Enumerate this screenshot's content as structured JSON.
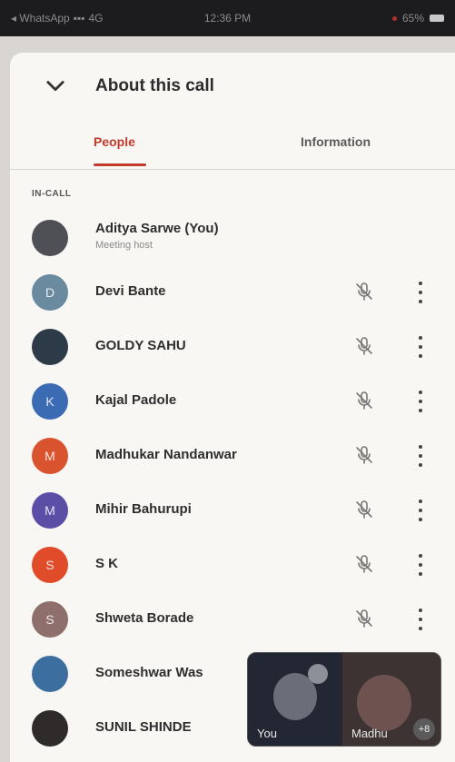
{
  "status_bar": {
    "carrier": "◂ WhatsApp",
    "network": "4G",
    "time": "12:36 PM",
    "battery": "65%"
  },
  "header": {
    "title": "About this call",
    "back_icon": "chevron-down-icon"
  },
  "tabs": [
    {
      "label": "People",
      "active": true
    },
    {
      "label": "Information",
      "active": false
    }
  ],
  "section_label": "IN-CALL",
  "participants": [
    {
      "name": "Aditya Sarwe (You)",
      "subtitle": "Meeting host",
      "initial": "",
      "avatar_color": "#4e5055",
      "is_host": true
    },
    {
      "name": "Devi Bante",
      "initial": "D",
      "avatar_color": "#6a8aa0"
    },
    {
      "name": "GOLDY SAHU",
      "initial": "",
      "avatar_color": "#2d3a48"
    },
    {
      "name": "Kajal Padole",
      "initial": "K",
      "avatar_color": "#3b6bb3"
    },
    {
      "name": "Madhukar Nandanwar",
      "initial": "M",
      "avatar_color": "#d9532e"
    },
    {
      "name": "Mihir Bahurupi",
      "initial": "M",
      "avatar_color": "#5b4ea6"
    },
    {
      "name": "S K",
      "initial": "S",
      "avatar_color": "#e04b2a"
    },
    {
      "name": "Shweta Borade",
      "initial": "S",
      "avatar_color": "#8e6f6b"
    },
    {
      "name": "Someshwar Was",
      "initial": "",
      "avatar_color": "#3d6ea0"
    },
    {
      "name": "SUNIL SHINDE",
      "initial": "",
      "avatar_color": "#2f2b2b"
    }
  ],
  "pip": {
    "self_label": "You",
    "other_label": "Madhu",
    "extra_count": "+8"
  },
  "colors": {
    "accent": "#c23a2c",
    "status_bar": "#1c1c1e",
    "sheet": "#f8f7f4"
  }
}
